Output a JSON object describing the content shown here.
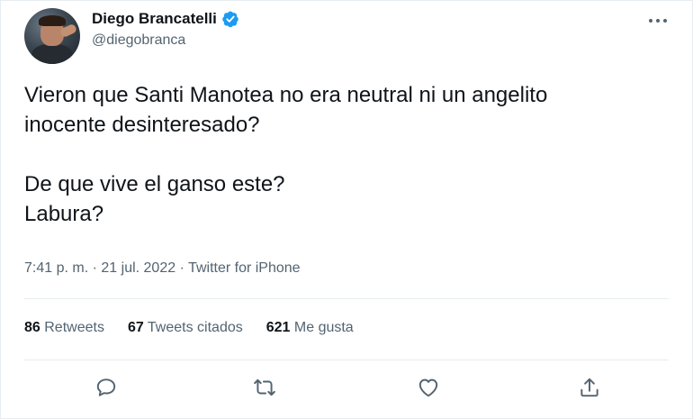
{
  "author": {
    "display_name": "Diego Brancatelli",
    "handle": "@diegobranca",
    "verified": true,
    "verified_color": "#1d9bf0"
  },
  "tweet": {
    "lines": [
      "Vieron que Santi Manotea no era neutral ni un angelito",
      "inocente desinteresado?",
      "De que vive el ganso este?",
      "Labura?"
    ],
    "time": "7:41 p. m.",
    "date": "21 jul. 2022",
    "source": "Twitter for iPhone",
    "separator": "·"
  },
  "stats": {
    "retweets_count": "86",
    "retweets_label": "Retweets",
    "quotes_count": "67",
    "quotes_label": "Tweets citados",
    "likes_count": "621",
    "likes_label": "Me gusta"
  },
  "icons": {
    "more": "more-horizontal-icon",
    "reply": "reply-icon",
    "retweet": "retweet-icon",
    "like": "heart-icon",
    "share": "share-icon"
  },
  "colors": {
    "text": "#0f1419",
    "secondary": "#536471",
    "divider": "#e6ecf0"
  }
}
